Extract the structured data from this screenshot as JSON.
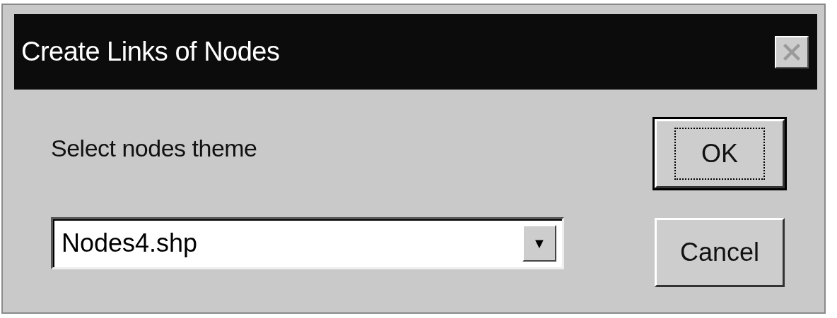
{
  "window": {
    "title": "Create Links of Nodes",
    "close_disabled": true
  },
  "label": "Select nodes theme",
  "combo": {
    "value": "Nodes4.shp",
    "arrow": "▼"
  },
  "buttons": [
    {
      "label": "OK",
      "default": true
    },
    {
      "label": "Cancel",
      "default": false
    }
  ]
}
